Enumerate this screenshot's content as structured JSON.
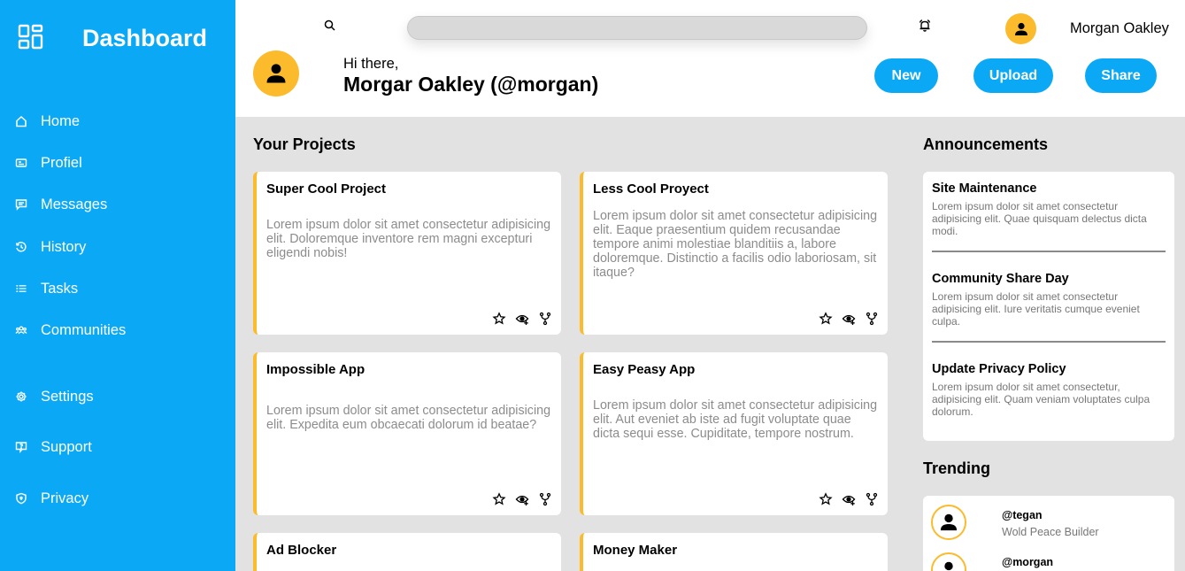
{
  "colors": {
    "sidebar": "#0ba9f5",
    "accent": "#fbbb2d",
    "background": "#e2e2e2"
  },
  "sidebar": {
    "brand": {
      "icon": "dashboard-grid-icon",
      "title": "Dashboard"
    },
    "items": [
      {
        "label": "Home",
        "icon": "home-icon"
      },
      {
        "label": "Profiel",
        "icon": "id-card-icon"
      },
      {
        "label": "Messages",
        "icon": "message-icon"
      },
      {
        "label": "History",
        "icon": "history-icon"
      },
      {
        "label": "Tasks",
        "icon": "list-icon"
      },
      {
        "label": "Communities",
        "icon": "people-icon"
      },
      {
        "label": "Settings",
        "icon": "gear-icon"
      },
      {
        "label": "Support",
        "icon": "support-icon"
      },
      {
        "label": "Privacy",
        "icon": "shield-icon"
      }
    ]
  },
  "header": {
    "search": {
      "placeholder": ""
    },
    "user_name": "Morgan Oakley",
    "greeting": "Hi there,",
    "full_name": "Morgar Oakley (@morgan)",
    "buttons": {
      "new": "New",
      "upload": "Upload",
      "share": "Share"
    }
  },
  "projects": {
    "title": "Your Projects",
    "items": [
      {
        "title": "Super Cool Project",
        "description": "Lorem ipsum dolor sit amet consectetur adipisicing elit. Doloremque inventore rem magni excepturi eligendi nobis!"
      },
      {
        "title": "Less Cool Proyect",
        "description": "Lorem ipsum dolor sit amet consectetur adipisicing elit. Eaque praesentium quidem recusandae tempore animi molestiae blanditiis a, labore doloremque. Distinctio a facilis odio laboriosam, sit itaque?"
      },
      {
        "title": "Impossible App",
        "description": "Lorem ipsum dolor sit amet consectetur adipisicing elit. Expedita eum obcaecati dolorum id beatae?"
      },
      {
        "title": "Easy Peasy App",
        "description": "Lorem ipsum dolor sit amet consectetur adipisicing elit. Aut eveniet ab iste ad fugit voluptate quae dicta sequi esse. Cupiditate, tempore nostrum."
      },
      {
        "title": "Ad Blocker",
        "description": ""
      },
      {
        "title": "Money Maker",
        "description": ""
      }
    ]
  },
  "announcements": {
    "title": "Announcements",
    "items": [
      {
        "title": "Site Maintenance",
        "text": "Lorem ipsum dolor sit amet consectetur adipisicing elit. Quae quisquam delectus dicta modi."
      },
      {
        "title": "Community Share Day",
        "text": "Lorem ipsum dolor sit amet consectetur adipisicing elit. Iure veritatis cumque eveniet culpa."
      },
      {
        "title": "Update Privacy Policy",
        "text": "Lorem ipsum dolor sit amet consectetur, adipisicing elit. Quam veniam voluptates culpa dolorum."
      }
    ]
  },
  "trending": {
    "title": "Trending",
    "items": [
      {
        "handle": "@tegan",
        "role": "Wold Peace Builder"
      },
      {
        "handle": "@morgan",
        "role": ""
      }
    ]
  }
}
